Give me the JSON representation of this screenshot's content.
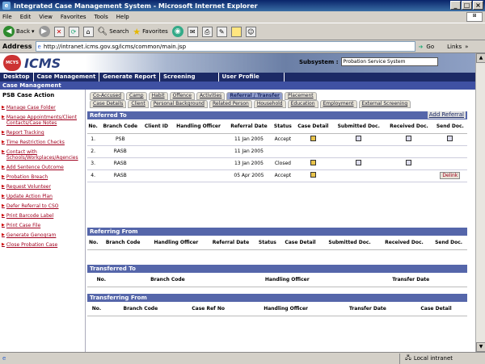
{
  "window": {
    "title": "Integrated Case Management System - Microsoft Internet Explorer"
  },
  "menu": [
    "File",
    "Edit",
    "View",
    "Favorites",
    "Tools",
    "Help"
  ],
  "toolbar": {
    "back": "Back",
    "search": "Search",
    "favorites": "Favorites"
  },
  "address": {
    "label": "Address",
    "url": "http://intranet.icms.gov.sg/icms/common/main.jsp",
    "go": "Go",
    "links": "Links"
  },
  "banner": {
    "logo": "ICMS",
    "ministry": "MCYS",
    "subsystem_label": "Subsystem :",
    "subsystem_value": "Probation Service System"
  },
  "nav": [
    "Desktop",
    "Case Management",
    "Generate Report",
    "Screening",
    "User Profile"
  ],
  "section_bar": "Case Management",
  "sidebar": {
    "title": "PSB Case Action",
    "items": [
      "Manage Case Folder",
      "Manage Appointments/Client Contacts/Case Notes",
      "Report Tracking",
      "Time Restriction Checks",
      "Contact with Schools/Workplaces/Agencies",
      "Add Sentence Outcome",
      "Probation Breach",
      "Request Volunteer",
      "Update Action Plan",
      "Defer Referral to CSO",
      "Print Barcode Label",
      "Print Case File",
      "Generate Genogram",
      "Close Probation Case"
    ]
  },
  "tabs_row1": [
    "Co-Accused",
    "Camp",
    "Habit",
    "Offence",
    "Activities",
    "Referral / Transfer",
    "Placement"
  ],
  "tabs_row2": [
    "Case Details",
    "Client",
    "Personal Background",
    "Related Person",
    "Household",
    "Education",
    "Employment",
    "External Screening"
  ],
  "referred_to": {
    "title": "Referred To",
    "add_label": "Add Referral",
    "headers": [
      "No.",
      "Branch Code",
      "Client ID",
      "Handling Officer",
      "Referral Date",
      "Status",
      "Case Detail",
      "Submitted Doc.",
      "Received Doc.",
      "Send Doc."
    ],
    "rows": [
      [
        "1.",
        "PSB",
        "",
        "",
        "11 Jan 2005",
        "Accept"
      ],
      [
        "2.",
        "RASB",
        "",
        "",
        "11 Jan 2005",
        ""
      ],
      [
        "3.",
        "RASB",
        "",
        "",
        "13 Jan 2005",
        "Closed"
      ],
      [
        "4.",
        "RASB",
        "",
        "",
        "05 Apr 2005",
        "Accept"
      ]
    ],
    "delink": "Delink"
  },
  "referring_from": {
    "title": "Referring From",
    "headers": [
      "No.",
      "Branch Code",
      "Handling Officer",
      "Referral Date",
      "Status",
      "Case Detail",
      "Submitted Doc.",
      "Received Doc.",
      "Send Doc."
    ]
  },
  "transferred_to": {
    "title": "Transferred To",
    "headers": [
      "No.",
      "Branch Code",
      "Handling Officer",
      "Transfer Date"
    ]
  },
  "transferring_from": {
    "title": "Transferring From",
    "headers": [
      "No.",
      "Branch Code",
      "Case Ref No",
      "Handling Officer",
      "Transfer Date",
      "Case Detail"
    ]
  },
  "status": {
    "zone": "Local intranet"
  }
}
